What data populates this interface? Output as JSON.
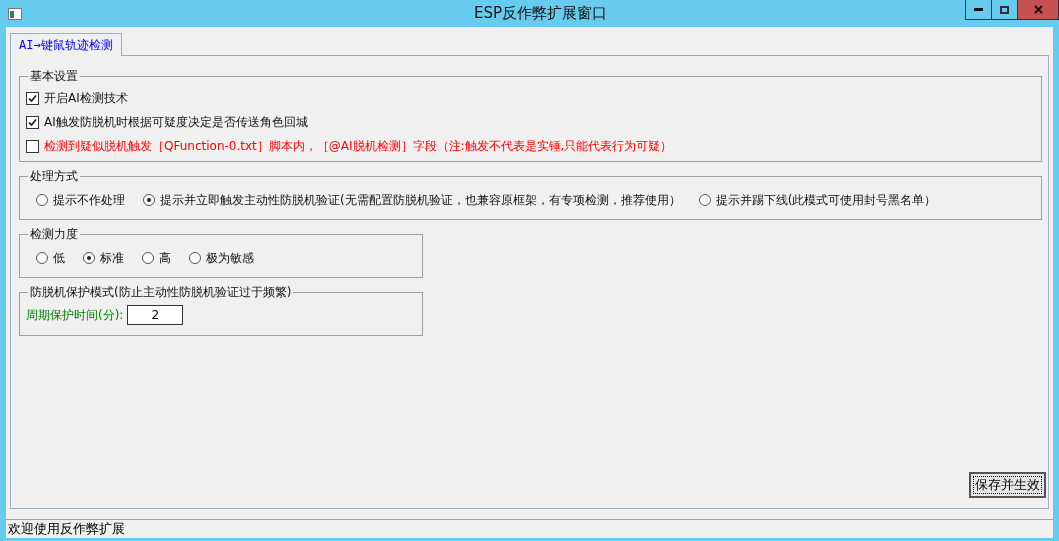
{
  "window": {
    "title": "ESP反作弊扩展窗口"
  },
  "tabs": [
    {
      "label": "AI→键鼠轨迹检测",
      "selected": true
    }
  ],
  "groups": [
    {
      "title": "基本设置",
      "kind": "checkboxes",
      "wide": true,
      "items": [
        {
          "label": "开启AI检测技术",
          "checked": true,
          "warning": false
        },
        {
          "label": "AI触发防脱机时根据可疑度决定是否传送角色回城",
          "checked": true,
          "warning": false
        },
        {
          "label": "检测到疑似脱机触发［QFunction-0.txt］脚本内，［@AI脱机检测］字段（注:触发不代表是实锤,只能代表行为可疑）",
          "checked": false,
          "warning": true
        }
      ]
    },
    {
      "title": "处理方式",
      "kind": "radios",
      "wide": true,
      "items": [
        {
          "label": "提示不作处理",
          "selected": false
        },
        {
          "label": "提示并立即触发主动性防脱机验证(无需配置防脱机验证，也兼容原框架，有专项检测，推荐使用）",
          "selected": true
        },
        {
          "label": "提示并踢下线(此模式可使用封号黑名单）",
          "selected": false
        }
      ]
    },
    {
      "title": "检测力度",
      "kind": "radios",
      "wide": false,
      "items": [
        {
          "label": "低",
          "selected": false
        },
        {
          "label": "标准",
          "selected": true
        },
        {
          "label": "高",
          "selected": false
        },
        {
          "label": "极为敏感",
          "selected": false
        }
      ]
    },
    {
      "title": "防脱机保护模式(防止主动性防脱机验证过于频繁)",
      "kind": "field",
      "wide": false,
      "label": "周期保护时间(分):",
      "value": "2"
    }
  ],
  "save_button": "保存并生效",
  "status_bar": "欢迎使用反作弊扩展"
}
